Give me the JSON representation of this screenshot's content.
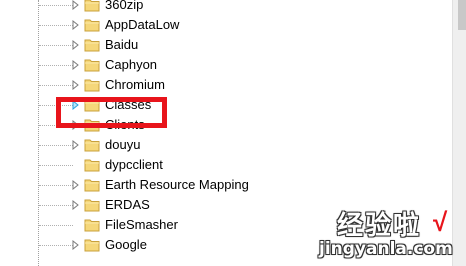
{
  "tree": {
    "items": [
      {
        "label": "360zip",
        "expandable": true
      },
      {
        "label": "AppDataLow",
        "expandable": true
      },
      {
        "label": "Baidu",
        "expandable": true
      },
      {
        "label": "Caphyon",
        "expandable": true
      },
      {
        "label": "Chromium",
        "expandable": true
      },
      {
        "label": "Classes",
        "expandable": true,
        "highlighted": true
      },
      {
        "label": "Clients",
        "expandable": true
      },
      {
        "label": "douyu",
        "expandable": true
      },
      {
        "label": "dypcclient",
        "expandable": false
      },
      {
        "label": "Earth Resource Mapping",
        "expandable": true
      },
      {
        "label": "ERDAS",
        "expandable": true
      },
      {
        "label": "FileSmasher",
        "expandable": false
      },
      {
        "label": "Google",
        "expandable": true
      }
    ]
  },
  "colors": {
    "highlight_border": "#e8141b",
    "folder_fill": "#f5d77a",
    "folder_edge": "#c9a13b",
    "hover_expander": "#2aa3e0"
  },
  "watermark": {
    "text_cn": "经验啦",
    "check": "√",
    "text_en": "jingyanla.com"
  }
}
